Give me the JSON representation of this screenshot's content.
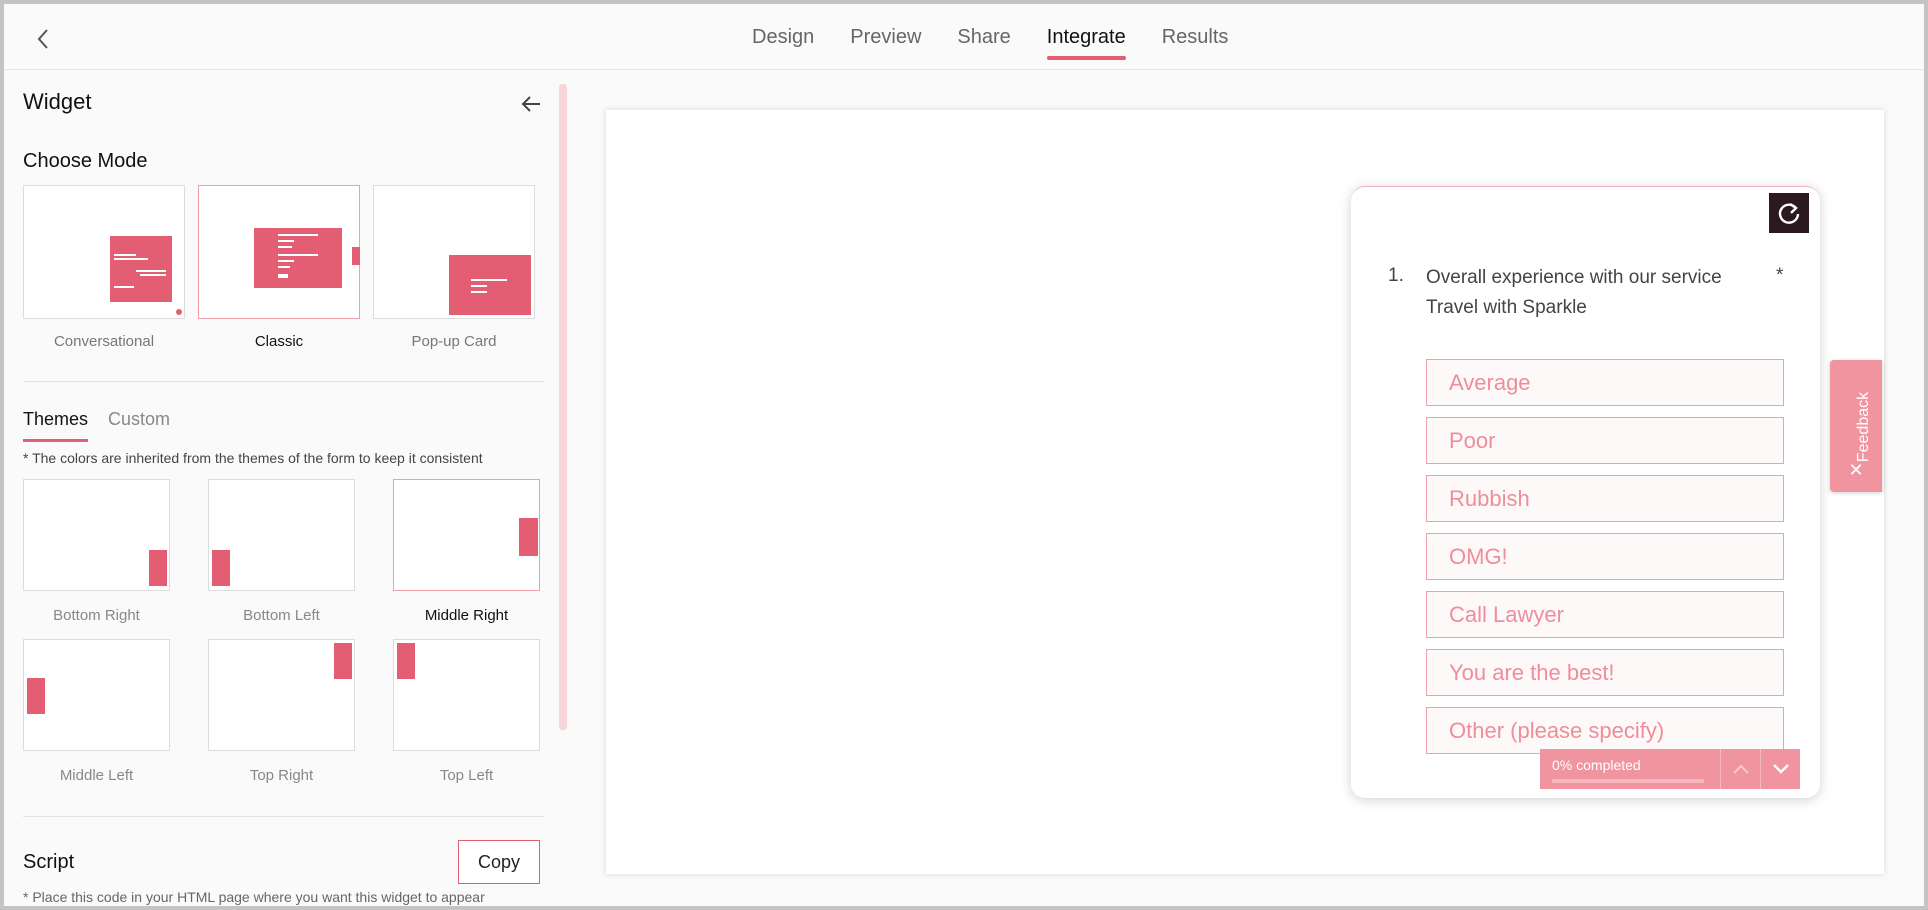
{
  "nav": {
    "tabs": [
      {
        "label": "Design"
      },
      {
        "label": "Preview"
      },
      {
        "label": "Share"
      },
      {
        "label": "Integrate",
        "active": true
      },
      {
        "label": "Results"
      }
    ]
  },
  "panel": {
    "title": "Widget",
    "choose_mode_label": "Choose Mode",
    "modes": [
      {
        "label": "Conversational"
      },
      {
        "label": "Classic",
        "selected": true
      },
      {
        "label": "Pop-up Card"
      }
    ],
    "theme_tabs": [
      {
        "label": "Themes",
        "active": true
      },
      {
        "label": "Custom"
      }
    ],
    "theme_note": "* The colors are inherited from the themes of the form to keep it consistent",
    "positions": [
      {
        "label": "Bottom Right"
      },
      {
        "label": "Bottom Left"
      },
      {
        "label": "Middle Right",
        "selected": true
      },
      {
        "label": "Middle Left"
      },
      {
        "label": "Top Right"
      },
      {
        "label": "Top Left"
      }
    ],
    "script_label": "Script",
    "copy_label": "Copy",
    "script_note": "* Place this code in your HTML page where you want this widget to appear"
  },
  "widget": {
    "question_number": "1.",
    "question_text": "Overall experience with our service Travel with Sparkle",
    "required_mark": "*",
    "options": [
      "Average",
      "Poor",
      "Rubbish",
      "OMG!",
      "Call Lawyer",
      "You are the best!",
      "Other (please specify)"
    ],
    "progress_text": "0% completed",
    "progress_value": 0,
    "feedback_label": "Feedback",
    "feedback_close": "✕"
  },
  "colors": {
    "accent": "#e35d73",
    "accent_light": "#f0949f",
    "option_border": "#f0a0ab",
    "refresh_bg": "#2a1a1e"
  }
}
